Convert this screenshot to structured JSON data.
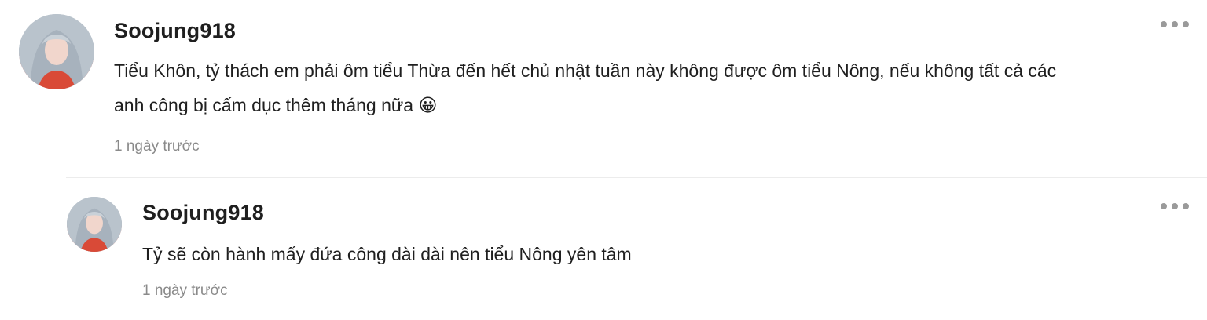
{
  "comments": [
    {
      "username": "Soojung918",
      "text_line1": "Tiểu Khôn, tỷ thách em phải ôm tiểu Thừa đến hết chủ nhật tuần này không được ôm tiểu Nông, nếu không tất cả các",
      "text_line2": "anh công bị cấm dục thêm tháng nữa",
      "emoji": "😀",
      "timestamp": "1 ngày trước",
      "avatar_icon": "profile-photo"
    },
    {
      "username": "Soojung918",
      "text": "Tỷ sẽ còn hành mấy đứa công dài dài nên tiểu Nông yên tâm",
      "timestamp": "1 ngày trước",
      "avatar_icon": "profile-photo"
    }
  ],
  "more_icon": "more-horizontal-icon",
  "colors": {
    "text": "#1f1f1f",
    "timestamp": "#8a8a8a",
    "dots": "#9a9a9a"
  }
}
